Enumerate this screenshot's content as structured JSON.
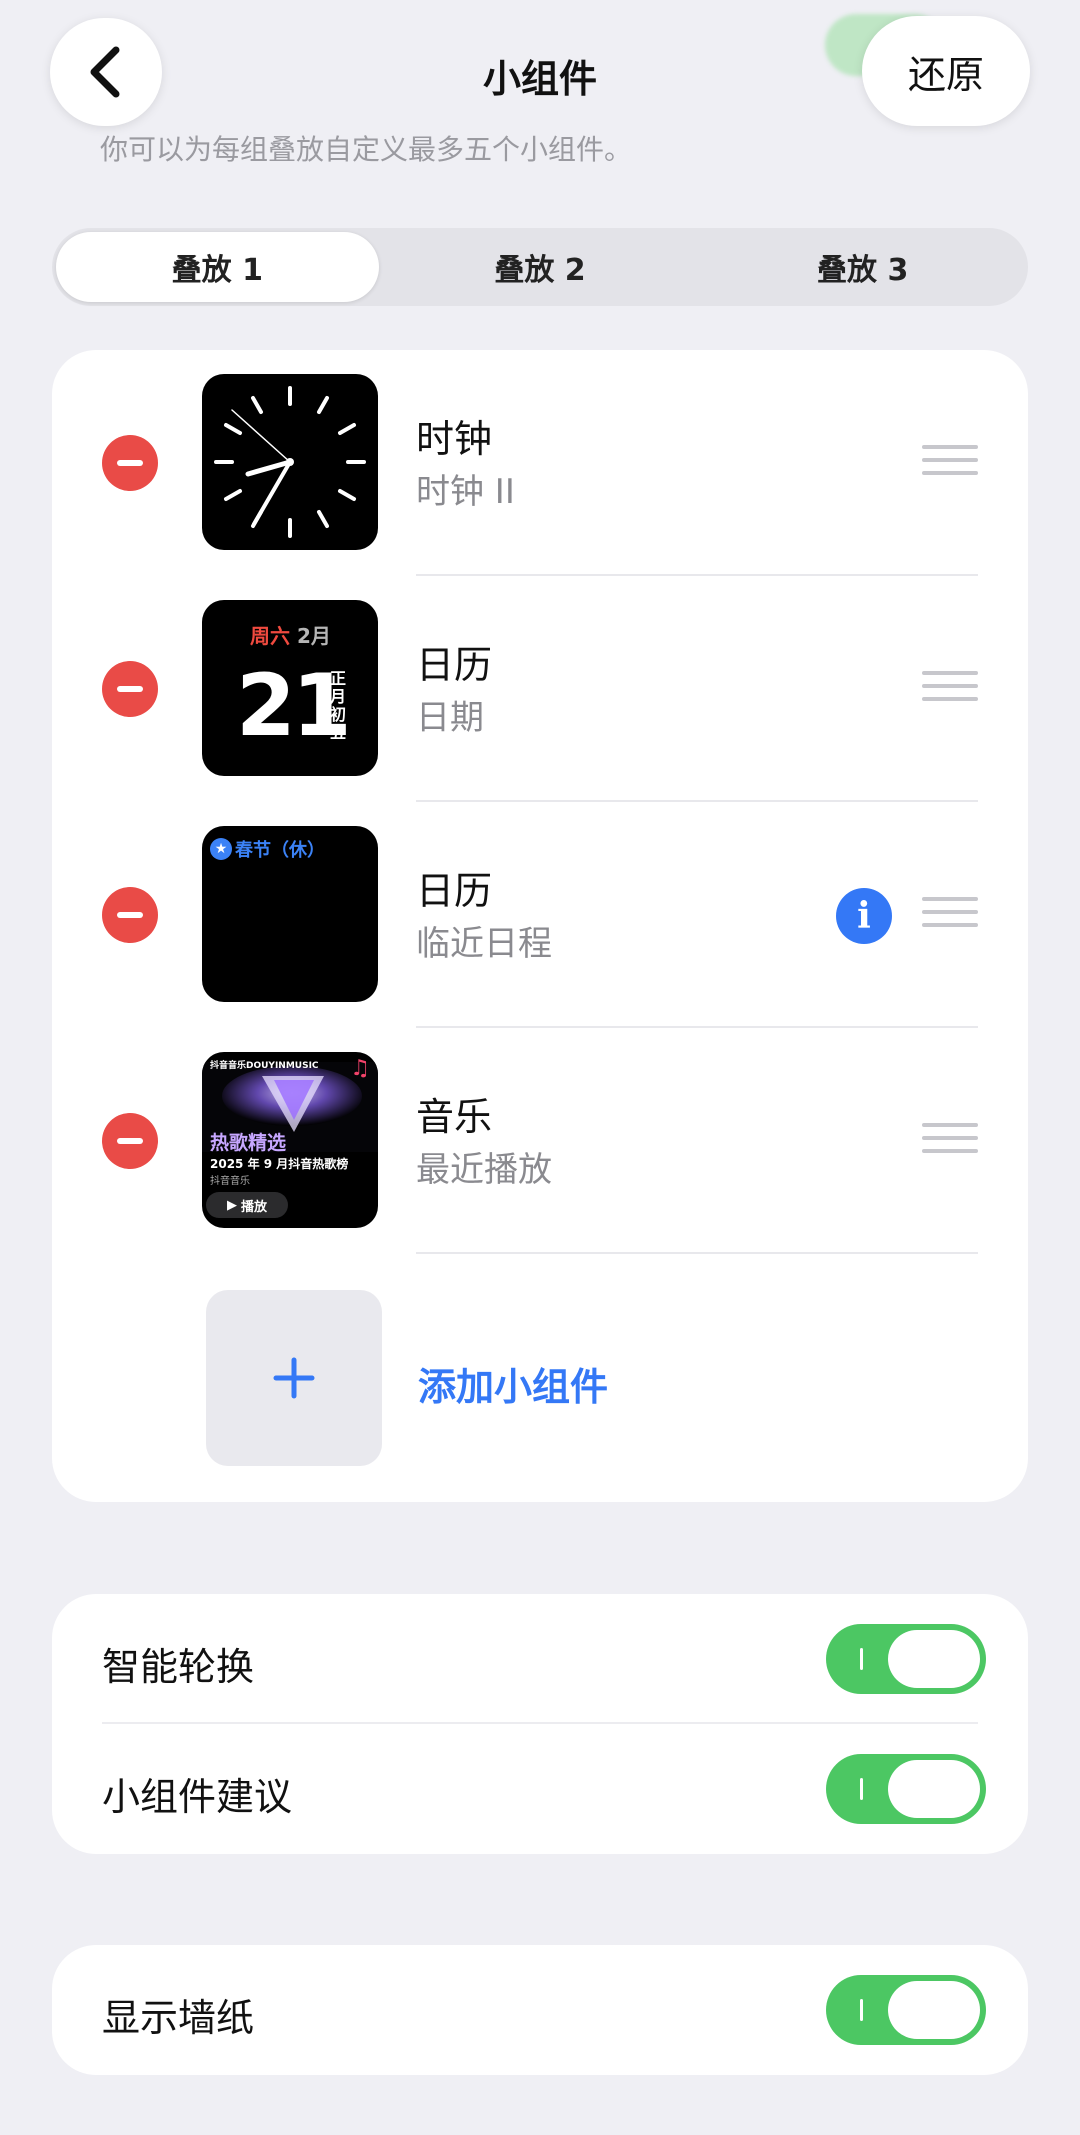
{
  "header": {
    "title": "小组件",
    "restore_label": "还原",
    "subtitle": "你可以为每组叠放自定义最多五个小组件。"
  },
  "tabs": [
    {
      "label": "叠放 1",
      "active": true
    },
    {
      "label": "叠放 2",
      "active": false
    },
    {
      "label": "叠放 3",
      "active": false
    }
  ],
  "widgets": [
    {
      "title": "时钟",
      "subtitle": "时钟 II",
      "icon": "clock-widget"
    },
    {
      "title": "日历",
      "subtitle": "日期",
      "icon": "calendar-date-widget",
      "preview": {
        "weekday": "周六",
        "month": "2月",
        "day": "21",
        "lunar": "正月初五"
      }
    },
    {
      "title": "日历",
      "subtitle": "临近日程",
      "icon": "calendar-upcoming-widget",
      "has_info": true,
      "preview": {
        "event": "春节（休）"
      }
    },
    {
      "title": "音乐",
      "subtitle": "最近播放",
      "icon": "music-widget",
      "preview": {
        "source": "抖音音乐DOUYINMUSIC",
        "playlist": "热歌精选",
        "line1": "2025 年 9 月抖音热歌榜",
        "line2": "抖音音乐",
        "play": "播放"
      }
    }
  ],
  "add_widget_label": "添加小组件",
  "settings": {
    "group1": [
      {
        "label": "智能轮换",
        "on": true
      },
      {
        "label": "小组件建议",
        "on": true
      }
    ],
    "group2": [
      {
        "label": "显示墙纸",
        "on": true
      }
    ]
  },
  "colors": {
    "accent": "#3478f6",
    "remove": "#e94b47",
    "toggle_on": "#4cc763",
    "calendar_weekday": "#f04a3f"
  }
}
